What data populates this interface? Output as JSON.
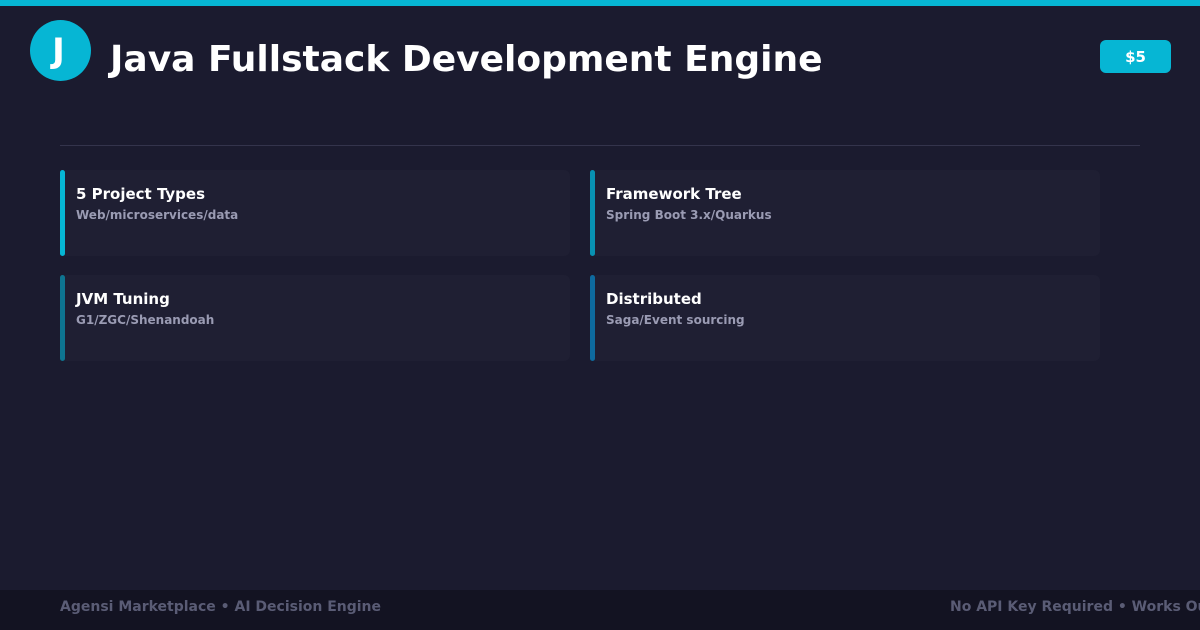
{
  "header": {
    "logo_letter": "J",
    "title": "Java Fullstack Development Engine",
    "price": "$5"
  },
  "features": [
    {
      "title": "5 Project Types",
      "subtitle": "Web/microservices/data",
      "accent_color": "#06b6d4"
    },
    {
      "title": "Framework Tree",
      "subtitle": "Spring Boot 3.x/Quarkus",
      "accent_color": "#0891b2"
    },
    {
      "title": "JVM Tuning",
      "subtitle": "G1/ZGC/Shenandoah",
      "accent_color": "#0e7490"
    },
    {
      "title": "Distributed",
      "subtitle": "Saga/Event sourcing",
      "accent_color": "#0e6a9e"
    }
  ],
  "footer": {
    "left_text": "Agensi Marketplace • AI Decision Engine",
    "right_text": "No API Key Required • Works Ou"
  },
  "colors": {
    "background": "#1b1b2f",
    "accent": "#06b6d4",
    "card_background": "#1f1f33",
    "footer_background": "#131322"
  }
}
